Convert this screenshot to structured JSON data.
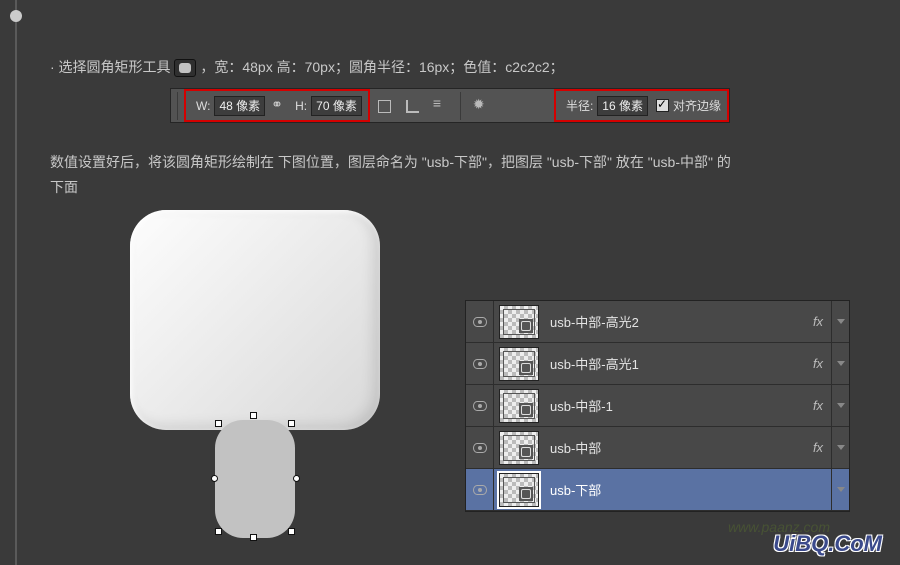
{
  "intro": {
    "select_text": "· 选择圆角矩形工具",
    "params_text": "，宽：48px  高：70px；圆角半径：16px；色值：c2c2c2；"
  },
  "toolbar": {
    "w_label": "W:",
    "w_value": "48 像素",
    "h_label": "H:",
    "h_value": "70 像素",
    "radius_label": "半径:",
    "radius_value": "16 像素",
    "align_edges": "对齐边缘"
  },
  "body_text": {
    "line1": "数值设置好后，将该圆角矩形绘制在 下图位置，图层命名为 \"usb-下部\"，把图层 \"usb-下部\" 放在 \"usb-中部\" 的",
    "line2": "下面"
  },
  "shape": {
    "color": "c2c2c2"
  },
  "layers": [
    {
      "name": "usb-中部-高光2",
      "fx": "fx",
      "selected": false
    },
    {
      "name": "usb-中部-高光1",
      "fx": "fx",
      "selected": false
    },
    {
      "name": "usb-中部-1",
      "fx": "fx",
      "selected": false
    },
    {
      "name": "usb-中部",
      "fx": "fx",
      "selected": false
    },
    {
      "name": "usb-下部",
      "fx": "",
      "selected": true
    }
  ],
  "watermark": {
    "ghost": "www.paanz.com",
    "logo": "UiBQ.CoM"
  }
}
